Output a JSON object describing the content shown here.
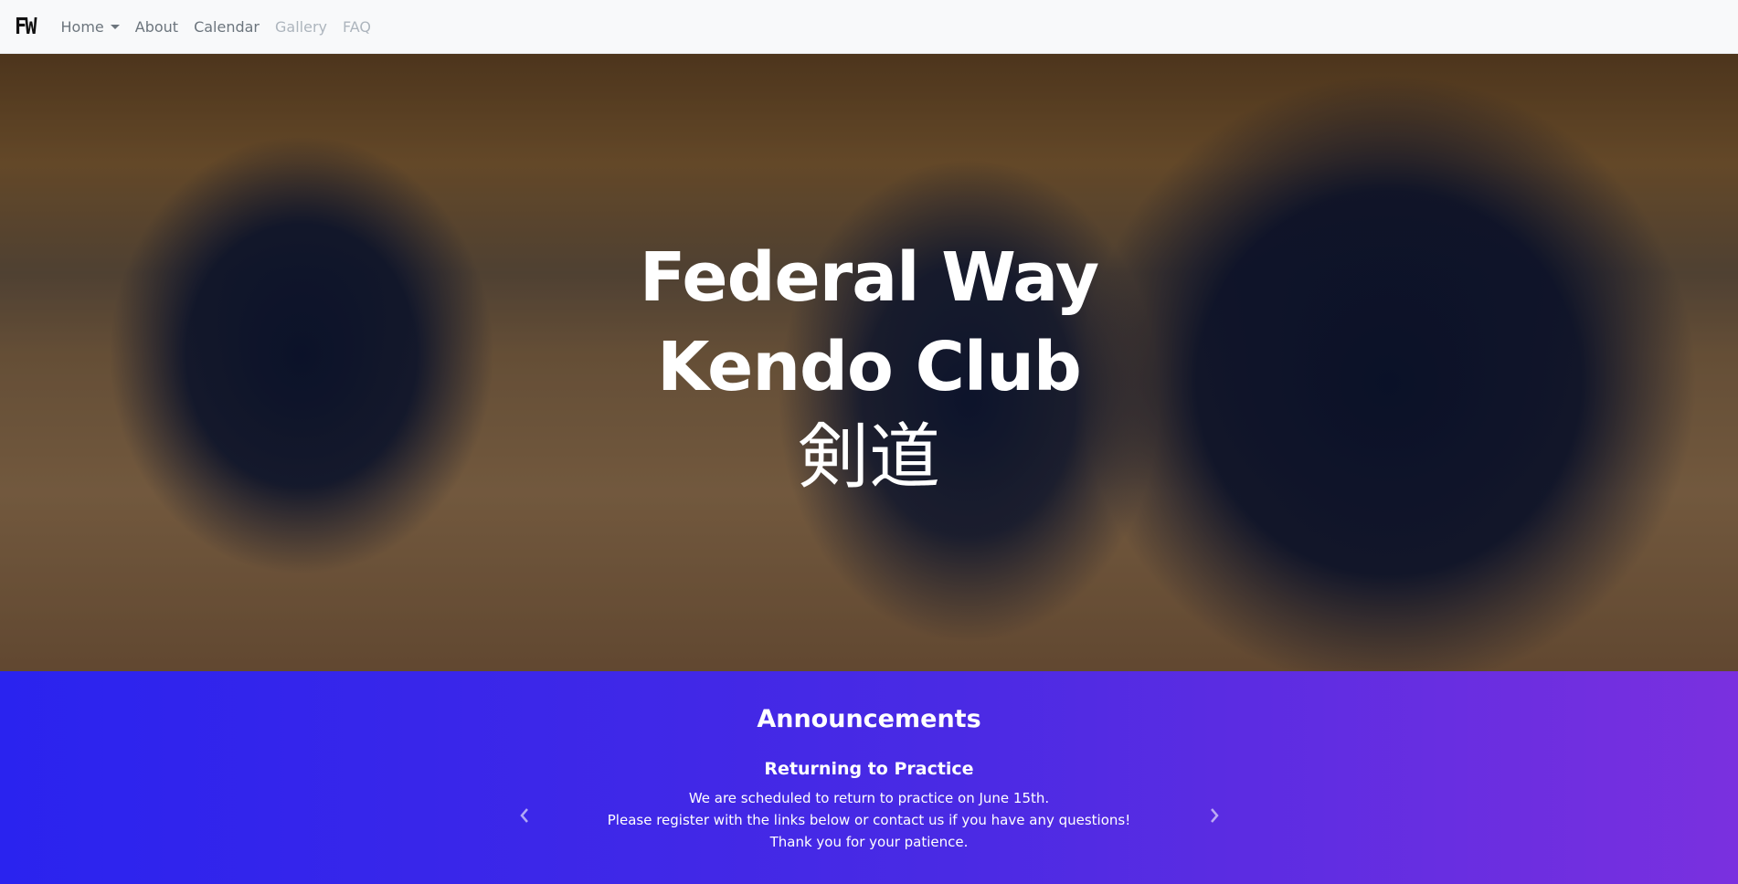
{
  "navbar": {
    "brand": "FW",
    "items": [
      {
        "label": "Home"
      },
      {
        "label": "About"
      },
      {
        "label": "Calendar"
      },
      {
        "label": "Gallery"
      },
      {
        "label": "FAQ"
      }
    ]
  },
  "hero": {
    "title_line1": "Federal Way",
    "title_line2": "Kendo Club",
    "kanji": "剣道"
  },
  "announcements": {
    "heading": "Announcements",
    "slide_title": "Returning to Practice",
    "lines": [
      "We are scheduled to return to practice on June 15th.",
      "Please register with the links below or contact us if you have any questions!",
      "Thank you for your patience."
    ]
  },
  "colors": {
    "navbar_bg": "#f8f9fa",
    "gradient_start": "#2a23ef",
    "gradient_end": "#7a30df"
  }
}
